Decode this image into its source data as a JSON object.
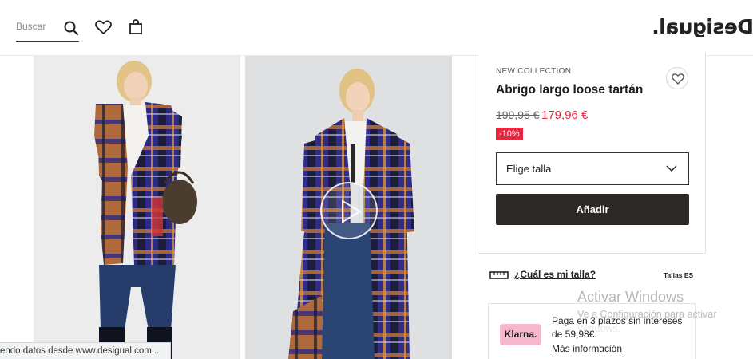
{
  "header": {
    "search_placeholder": "Buscar",
    "logo_text": "Desigual."
  },
  "images": [
    {
      "name": "model photo front"
    },
    {
      "name": "model photo video"
    }
  ],
  "product": {
    "collection": "NEW COLLECTION",
    "title": "Abrigo largo loose tartán",
    "old_price": "199,95 €",
    "new_price": "179,96 €",
    "discount": "-10%",
    "size_select_label": "Elige talla",
    "add_button": "Añadir"
  },
  "size_guide": {
    "link": "¿Cuál es mi talla?",
    "system": "Tallas ES"
  },
  "klarna": {
    "badge": "Klarna.",
    "text": "Paga en 3 plazos sin intereses de 59,98€.",
    "link": "Más información"
  },
  "watermark": {
    "title": "Activar Windows",
    "subtitle": "Ve a Configuración para activar",
    "subtitle2": "Windows."
  },
  "status_bar": "endo datos desde www.desigual.com...",
  "colors": {
    "accent_red": "#e4283f",
    "button_dark": "#2c2826",
    "klarna_pink": "#f6b7cd",
    "coat_blue": "#2c2c8a",
    "coat_orange": "#b56a3a"
  }
}
